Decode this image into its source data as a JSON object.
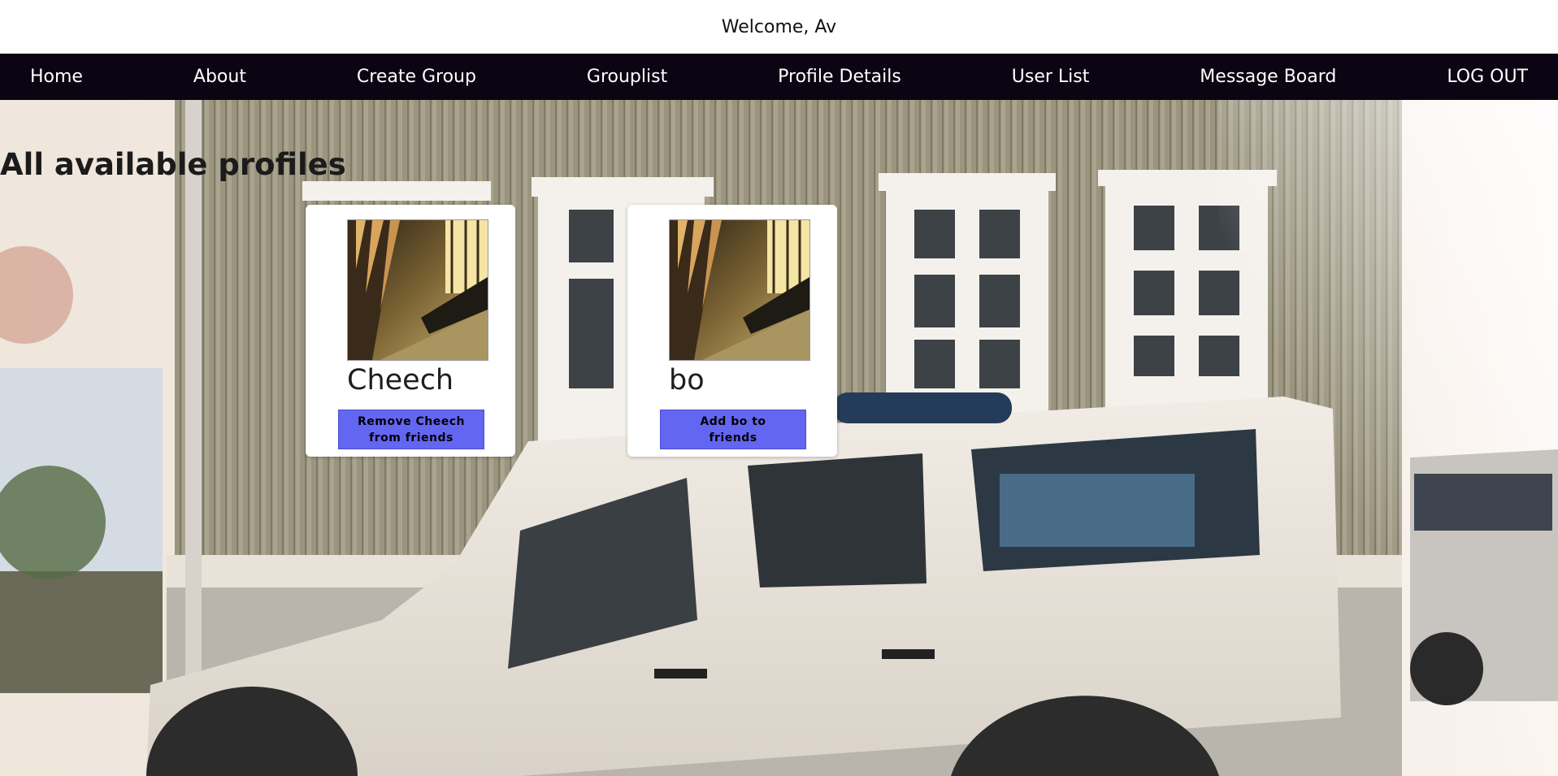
{
  "header": {
    "welcome_text": "Welcome, Av"
  },
  "nav": {
    "home": "Home",
    "about": "About",
    "create_group": "Create Group",
    "grouplist": "Grouplist",
    "profile_details": "Profile Details",
    "user_list": "User List",
    "message_board": "Message Board",
    "logout": "LOG OUT"
  },
  "main": {
    "title": "All available profiles",
    "profiles": [
      {
        "name": "Cheech",
        "button_label": "Remove Cheech from friends"
      },
      {
        "name": "bo",
        "button_label": "Add bo to friends"
      }
    ]
  },
  "colors": {
    "navbar_bg": "#0b0412",
    "button_bg": "#6366f1"
  },
  "icons": {
    "profile_picture": "profile-photo",
    "background": "background-photo"
  }
}
